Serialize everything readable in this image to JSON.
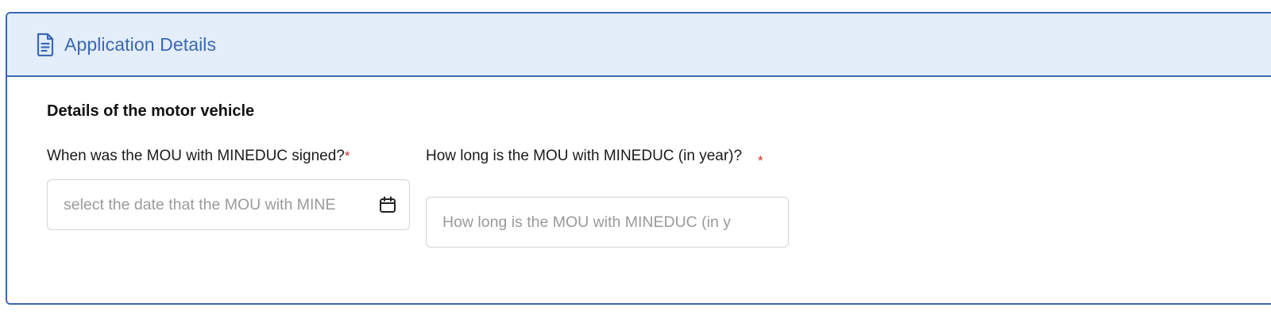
{
  "panel": {
    "title": "Application Details",
    "icon": "document-icon",
    "accent_color": "#3a68b5",
    "header_bg": "#e3eefa"
  },
  "section": {
    "title": "Details of the motor vehicle"
  },
  "fields": {
    "mou_signed_date": {
      "label": "When was the MOU with MINEDUC signed?",
      "required_marker": "*",
      "placeholder": "select the date that the MOU with MINE",
      "icon": "calendar-icon"
    },
    "mou_duration": {
      "label": "How long is the MOU with MINEDUC (in year)?",
      "required_marker": "*",
      "placeholder": "How long is the MOU with MINEDUC (in y"
    }
  }
}
